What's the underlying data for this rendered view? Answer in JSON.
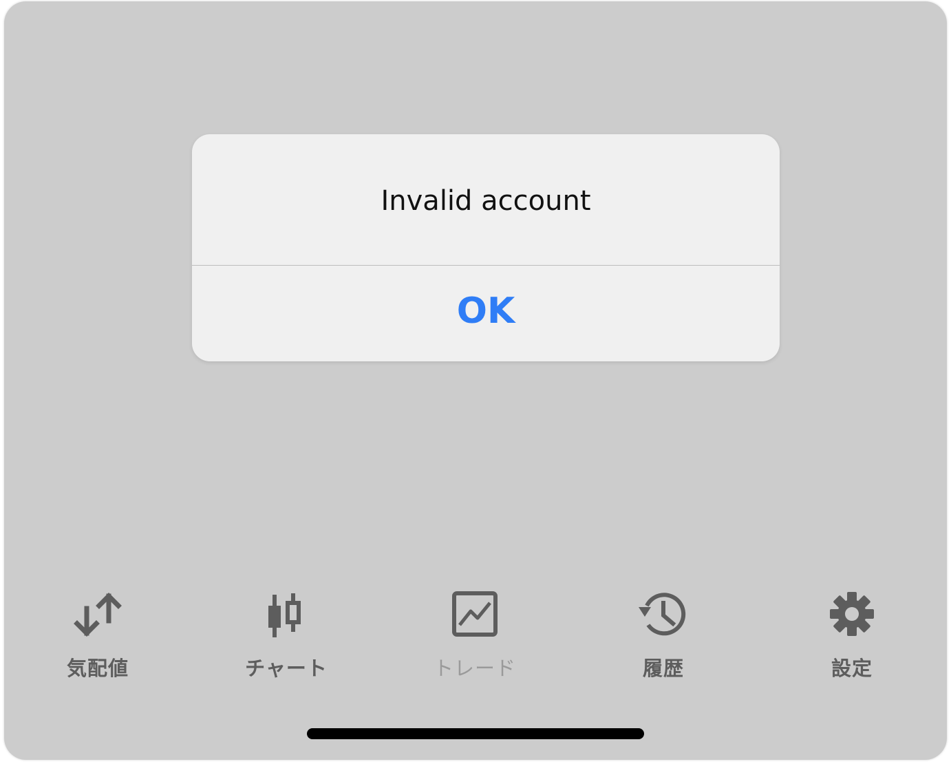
{
  "alert": {
    "message": "Invalid account",
    "ok_label": "OK"
  },
  "tabbar": {
    "items": [
      {
        "label": "気配値",
        "icon": "quotes-arrows-icon",
        "state": "normal"
      },
      {
        "label": "チャート",
        "icon": "candlestick-icon",
        "state": "normal"
      },
      {
        "label": "トレード",
        "icon": "trade-chart-icon",
        "state": "disabled"
      },
      {
        "label": "履歴",
        "icon": "history-clock-icon",
        "state": "normal"
      },
      {
        "label": "設定",
        "icon": "gear-icon",
        "state": "normal"
      }
    ]
  },
  "colors": {
    "backdrop": "#cccccc",
    "alert_background": "#f0f0f0",
    "accent": "#2f7df6",
    "icon": "#5d5d5d",
    "icon_disabled": "#9a9a9a"
  }
}
